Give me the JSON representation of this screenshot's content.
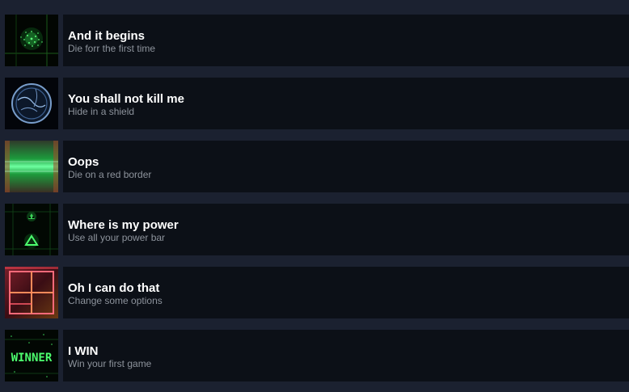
{
  "achievements": [
    {
      "title": "And it begins",
      "description": "Die forr the first time",
      "icon": "green-particle-burst-icon"
    },
    {
      "title": "You shall not kill me",
      "description": "Hide in a shield",
      "icon": "blue-shield-orb-icon"
    },
    {
      "title": "Oops",
      "description": "Die on a red border",
      "icon": "green-glow-border-icon"
    },
    {
      "title": "Where is my power",
      "description": "Use all your power bar",
      "icon": "green-triangle-ship-icon"
    },
    {
      "title": "Oh I can do that",
      "description": "Change some options",
      "icon": "red-grid-options-icon"
    },
    {
      "title": "I WIN",
      "description": "Win your first game",
      "icon": "winner-text-icon",
      "icon_text": "WINNER"
    }
  ]
}
